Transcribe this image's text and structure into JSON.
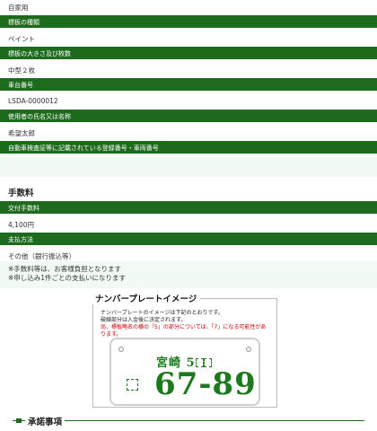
{
  "vehicle_use": "自家用",
  "fields": [
    {
      "label": "標板の種類",
      "value": "ペイント"
    },
    {
      "label": "標板の大きさ及び枚数",
      "value": "中型２枚"
    },
    {
      "label": "車台番号",
      "value": "LSDA-0000012"
    },
    {
      "label": "使用者の氏名又は名称",
      "value": "希望太郎"
    },
    {
      "label": "自動車検査証等に記載されている登録番号・車両番号",
      "value": ""
    }
  ],
  "fees": {
    "title": "手数料",
    "fields": [
      {
        "label": "交付手数料",
        "value": "4,100円"
      },
      {
        "label": "支払方法",
        "value": "その他（銀行振込等）"
      }
    ],
    "notes": [
      "※手数料等は、お客様負担となります",
      "※申し込み1件ごとの支払いになります"
    ]
  },
  "plate_image": {
    "title": "ナンバープレートイメージ",
    "desc_line1": "ナンバープレートのイメージは下記のとおりです。",
    "desc_line2": "破線部分は入金後に決定されます。",
    "desc_red": "尚、標板略名の横の「5」の部分については、「7」になる可能性があります。",
    "region": "宮崎 5",
    "number": "67-89",
    "text_color": "#1b7a1b"
  },
  "accept": {
    "title": "承諾事項"
  }
}
